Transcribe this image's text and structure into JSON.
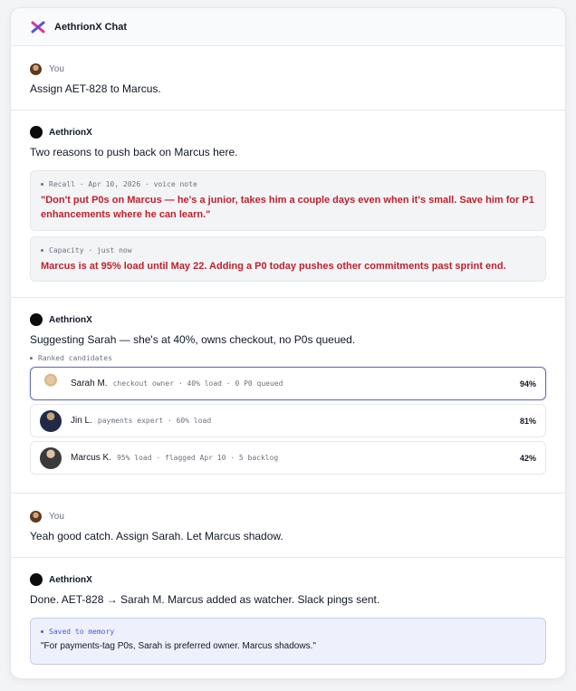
{
  "header": {
    "title": "AethrionX Chat"
  },
  "messages": {
    "m1": {
      "author": "You",
      "text": "Assign AET-828 to Marcus."
    },
    "m2": {
      "author": "AethrionX",
      "text": "Two reasons to push back on Marcus here.",
      "cards": [
        {
          "label": "Recall · Apr 10, 2026 · voice note",
          "text": "\"Don't put P0s on Marcus — he's a junior, takes him a couple days even when it's small. Save him for P1 enhancements where he can learn.\""
        },
        {
          "label": "Capacity · just now",
          "text": "Marcus is at 95% load until May 22. Adding a P0 today pushes other commitments past sprint end."
        }
      ]
    },
    "m3": {
      "author": "AethrionX",
      "text": "Suggesting Sarah — she's at 40%, owns checkout, no P0s queued.",
      "ranked_label": "Ranked candidates",
      "candidates": [
        {
          "name": "Sarah M.",
          "meta": "checkout owner · 40% load · 0 P0 queued",
          "score": "94%",
          "selected": true
        },
        {
          "name": "Jin L.",
          "meta": "payments expert · 60% load",
          "score": "81%",
          "selected": false
        },
        {
          "name": "Marcus K.",
          "meta": "95% load · flagged Apr 10 · 5 backlog",
          "score": "42%",
          "selected": false
        }
      ]
    },
    "m4": {
      "author": "You",
      "text": "Yeah good catch. Assign Sarah. Let Marcus shadow."
    },
    "m5": {
      "author": "AethrionX",
      "text": "Done. AET-828 → Sarah M. Marcus added as watcher. Slack pings sent.",
      "memory": {
        "label": "Saved to memory",
        "text": "\"For payments-tag P0s, Sarah is preferred owner. Marcus shadows.\""
      }
    }
  },
  "colors": {
    "accent": "#4f5bd5",
    "warning_text": "#c0202d",
    "selected_border": "#6a6fbf"
  },
  "icons": {
    "logo": "aethrionx-logo-icon",
    "user_avatar": "user-avatar-icon",
    "ai_avatar": "aethrionx-avatar-icon"
  }
}
